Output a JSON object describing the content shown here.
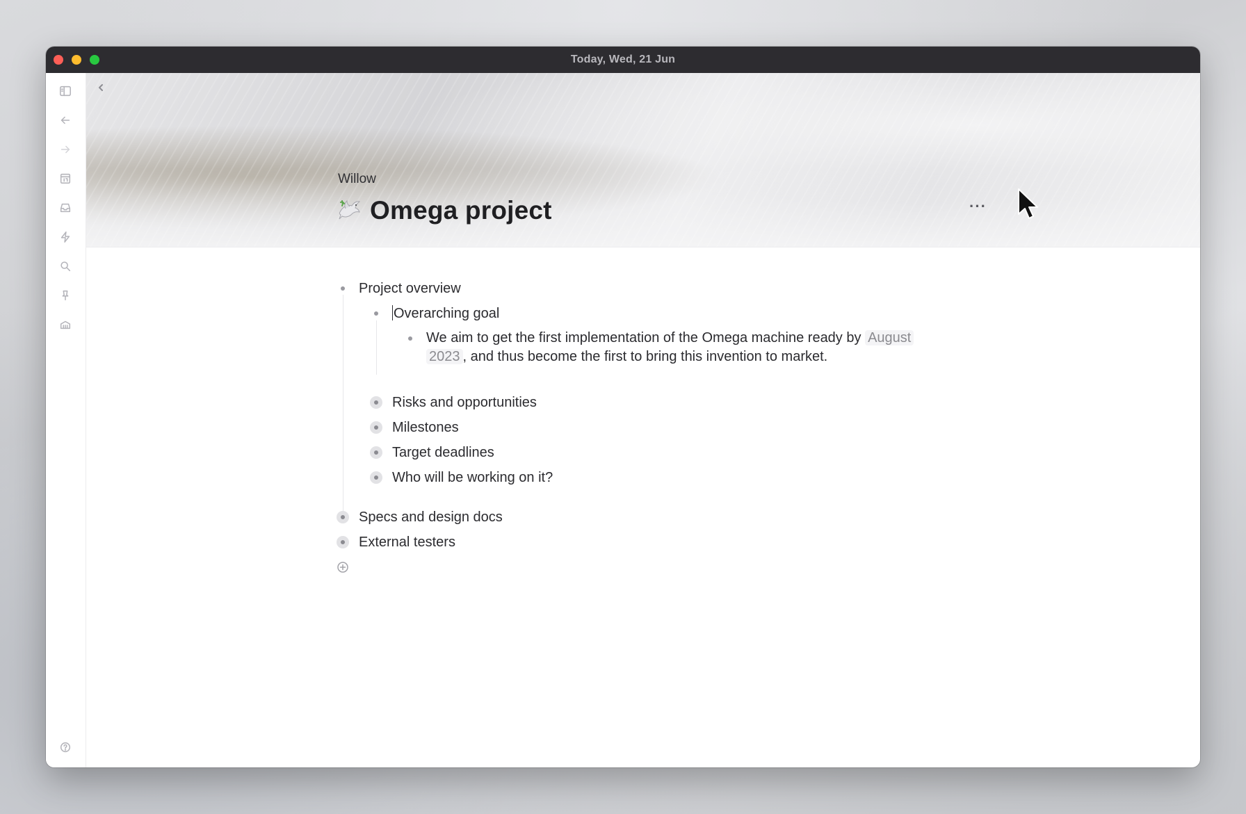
{
  "window": {
    "title": "Today, Wed, 21 Jun"
  },
  "sidebar": {
    "items": [
      {
        "icon": "sidebar-toggle-icon"
      },
      {
        "icon": "arrow-left-icon"
      },
      {
        "icon": "arrow-right-icon"
      },
      {
        "icon": "calendar-icon"
      },
      {
        "icon": "inbox-icon"
      },
      {
        "icon": "lightning-icon"
      },
      {
        "icon": "search-icon"
      },
      {
        "icon": "pin-icon"
      },
      {
        "icon": "library-icon"
      },
      {
        "icon": "help-icon"
      },
      {
        "icon": "settings-icon"
      }
    ]
  },
  "page": {
    "breadcrumb": "Willow",
    "title": "Omega project",
    "title_icon": "dove-icon",
    "more_label": "···"
  },
  "outline": {
    "project_overview": "Project overview",
    "overarching_goal": "Overarching goal",
    "goal_text_before": "We aim to get the first implementation of the Omega machine ready by",
    "goal_date_line1": "August",
    "goal_date_line2": "2023",
    "goal_text_after": ", and thus become the first to bring this invention to market.",
    "risks": "Risks and opportunities",
    "milestones": "Milestones",
    "deadlines": "Target deadlines",
    "who": "Who will be working on it?",
    "specs": "Specs and design docs",
    "testers": "External testers"
  }
}
